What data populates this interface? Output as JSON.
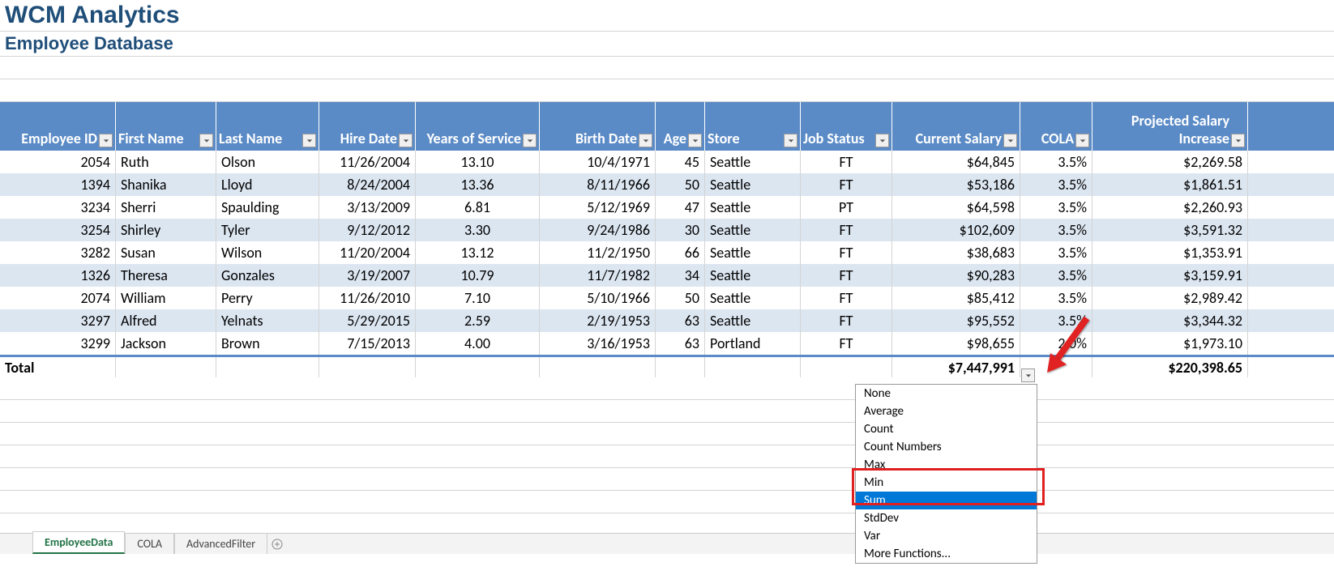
{
  "title": "WCM Analytics",
  "subtitle": "Employee Database",
  "headers": [
    "Employee ID",
    "First Name",
    "Last Name",
    "Hire Date",
    "Years of Service",
    "Birth Date",
    "Age",
    "Store",
    "Job Status",
    "Current Salary",
    "COLA",
    "Projected Salary\nIncrease"
  ],
  "rows": [
    {
      "id": "2054",
      "fn": "Ruth",
      "ln": "Olson",
      "hire": "11/26/2004",
      "yrs": "13.10",
      "birth": "10/4/1971",
      "age": "45",
      "store": "Seattle",
      "job": "FT",
      "sal": "$64,845",
      "cola": "3.5%",
      "proj": "$2,269.58"
    },
    {
      "id": "1394",
      "fn": "Shanika",
      "ln": "Lloyd",
      "hire": "8/24/2004",
      "yrs": "13.36",
      "birth": "8/11/1966",
      "age": "50",
      "store": "Seattle",
      "job": "FT",
      "sal": "$53,186",
      "cola": "3.5%",
      "proj": "$1,861.51"
    },
    {
      "id": "3234",
      "fn": "Sherri",
      "ln": "Spaulding",
      "hire": "3/13/2009",
      "yrs": "6.81",
      "birth": "5/12/1969",
      "age": "47",
      "store": "Seattle",
      "job": "PT",
      "sal": "$64,598",
      "cola": "3.5%",
      "proj": "$2,260.93"
    },
    {
      "id": "3254",
      "fn": "Shirley",
      "ln": "Tyler",
      "hire": "9/12/2012",
      "yrs": "3.30",
      "birth": "9/24/1986",
      "age": "30",
      "store": "Seattle",
      "job": "FT",
      "sal": "$102,609",
      "cola": "3.5%",
      "proj": "$3,591.32"
    },
    {
      "id": "3282",
      "fn": "Susan",
      "ln": "Wilson",
      "hire": "11/20/2004",
      "yrs": "13.12",
      "birth": "11/2/1950",
      "age": "66",
      "store": "Seattle",
      "job": "FT",
      "sal": "$38,683",
      "cola": "3.5%",
      "proj": "$1,353.91"
    },
    {
      "id": "1326",
      "fn": "Theresa",
      "ln": "Gonzales",
      "hire": "3/19/2007",
      "yrs": "10.79",
      "birth": "11/7/1982",
      "age": "34",
      "store": "Seattle",
      "job": "FT",
      "sal": "$90,283",
      "cola": "3.5%",
      "proj": "$3,159.91"
    },
    {
      "id": "2074",
      "fn": "William",
      "ln": "Perry",
      "hire": "11/26/2010",
      "yrs": "7.10",
      "birth": "5/10/1966",
      "age": "50",
      "store": "Seattle",
      "job": "FT",
      "sal": "$85,412",
      "cola": "3.5%",
      "proj": "$2,989.42"
    },
    {
      "id": "3297",
      "fn": "Alfred",
      "ln": "Yelnats",
      "hire": "5/29/2015",
      "yrs": "2.59",
      "birth": "2/19/1953",
      "age": "63",
      "store": "Seattle",
      "job": "FT",
      "sal": "$95,552",
      "cola": "3.5%",
      "proj": "$3,344.32"
    },
    {
      "id": "3299",
      "fn": "Jackson",
      "ln": "Brown",
      "hire": "7/15/2013",
      "yrs": "4.00",
      "birth": "3/16/1953",
      "age": "63",
      "store": "Portland",
      "job": "FT",
      "sal": "$98,655",
      "cola": "2.0%",
      "proj": "$1,973.10"
    }
  ],
  "total_label": "Total",
  "total_salary": "$7,447,991",
  "total_proj": "$220,398.65",
  "dropdown": {
    "items": [
      "None",
      "Average",
      "Count",
      "Count Numbers",
      "Max",
      "Min",
      "Sum",
      "StdDev",
      "Var",
      "More Functions..."
    ],
    "selected": "Sum"
  },
  "tabs": [
    "EmployeeData",
    "COLA",
    "AdvancedFilter"
  ],
  "active_tab": "EmployeeData"
}
